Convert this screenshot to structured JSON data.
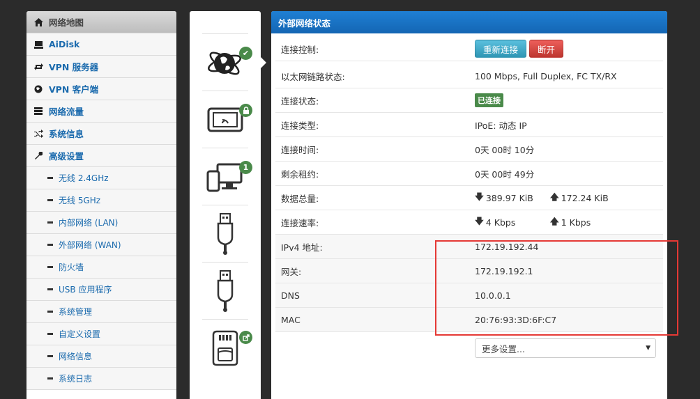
{
  "sidebar": {
    "items": [
      {
        "label": "网络地图",
        "icon": "home-icon"
      },
      {
        "label": "AiDisk",
        "icon": "drive-icon"
      },
      {
        "label": "VPN 服务器",
        "icon": "vpn-server-icon"
      },
      {
        "label": "VPN 客户端",
        "icon": "globe-icon"
      },
      {
        "label": "网络流量",
        "icon": "list-icon"
      },
      {
        "label": "系统信息",
        "icon": "shuffle-icon"
      },
      {
        "label": "高级设置",
        "icon": "wrench-icon"
      }
    ],
    "subitems": [
      "无线 2.4GHz",
      "无线 5GHz",
      "内部网络 (LAN)",
      "外部网络 (WAN)",
      "防火墙",
      "USB 应用程序",
      "系统管理",
      "自定义设置",
      "网络信息",
      "系统日志"
    ]
  },
  "iconcol": {
    "badges": {
      "clients": "1"
    }
  },
  "panel": {
    "title": "外部网络状态",
    "rows": {
      "control": {
        "label": "连接控制:",
        "reconnect": "重新连接",
        "disconnect": "断开"
      },
      "ethernet": {
        "label": "以太网链路状态:",
        "value": "100 Mbps, Full Duplex, FC TX/RX"
      },
      "status": {
        "label": "连接状态:",
        "value": "已连接"
      },
      "type": {
        "label": "连接类型:",
        "value": "IPoE: 动态 IP"
      },
      "uptime": {
        "label": "连接时间:",
        "value": "0天 00时 10分"
      },
      "lease": {
        "label": "剩余租约:",
        "value": "0天 00时 49分"
      },
      "data": {
        "label": "数据总量:",
        "down": "389.97 KiB",
        "up": "172.24 KiB"
      },
      "rate": {
        "label": "连接速率:",
        "down": "4 Kbps",
        "up": "1 Kbps"
      },
      "ipv4": {
        "label": "IPv4 地址:",
        "value": "172.19.192.44"
      },
      "gateway": {
        "label": "网关:",
        "value": "172.19.192.1"
      },
      "dns": {
        "label": "DNS",
        "value": "10.0.0.1"
      },
      "mac": {
        "label": "MAC",
        "value": "20:76:93:3D:6F:C7"
      }
    },
    "more_settings": "更多设置..."
  },
  "colors": {
    "accent": "#1a6aad",
    "header": "#1466b4",
    "success": "#4a8a4a",
    "danger": "#bd362f",
    "highlight": "#e53935"
  }
}
